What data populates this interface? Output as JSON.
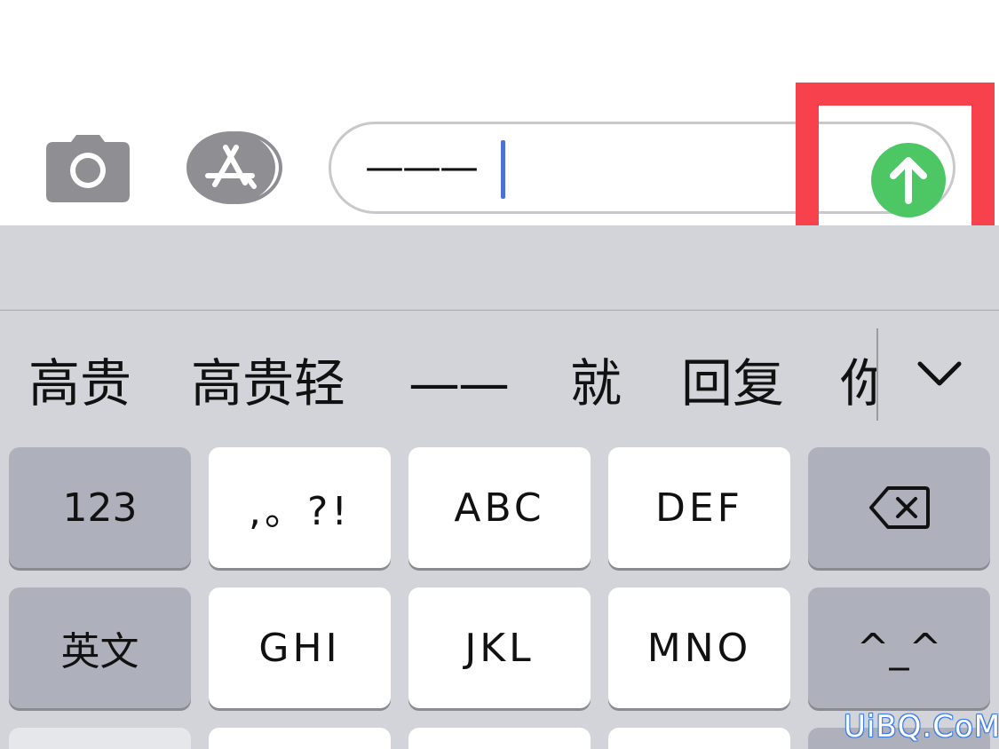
{
  "compose": {
    "camera_icon": "camera-icon",
    "appstore_icon": "app-store-icon",
    "message_text": "———",
    "send_icon": "arrow-up-circle-icon",
    "send_color": "#4cc764",
    "highlight_color": "#f7414c"
  },
  "keyboard": {
    "candidates": [
      "高贵",
      "高贵轻",
      "——",
      "就",
      "回复",
      "你"
    ],
    "expand_icon": "chevron-down-icon",
    "keys": {
      "numbers": "123",
      "punctuation": ",。?!",
      "abc": "ABC",
      "def": "DEF",
      "delete_icon": "delete-backspace-icon",
      "english": "英文",
      "ghi": "GHI",
      "jkl": "JKL",
      "mno": "MNO",
      "emoticon": "^_^"
    },
    "background_color": "#d3d4d9",
    "function_key_color": "#aeb1bb"
  },
  "watermark": "UiBQ.CoM"
}
